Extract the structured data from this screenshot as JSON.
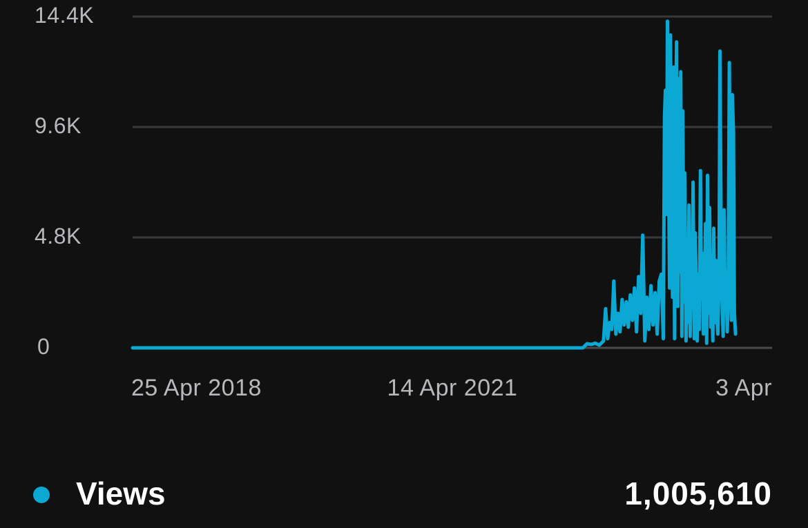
{
  "colors": {
    "background": "#111112",
    "series": "#0aa8d3",
    "grid": "#38383c",
    "tick_text": "#b8b8bd"
  },
  "chart_data": {
    "type": "line",
    "grid": true,
    "ylim": [
      0,
      14400
    ],
    "y_ticks": [
      {
        "value": 0,
        "label": "0"
      },
      {
        "value": 4800,
        "label": "4.8K"
      },
      {
        "value": 9600,
        "label": "9.6K"
      },
      {
        "value": 14400,
        "label": "14.4K"
      }
    ],
    "xlim": [
      "2018-04-25",
      "2024-04-03"
    ],
    "x_ticks": [
      {
        "value": "2018-04-25",
        "label": "25 Apr 2018"
      },
      {
        "value": "2021-04-14",
        "label": "14 Apr 2021"
      },
      {
        "value": "2024-04-03",
        "label": "3 Apr"
      }
    ],
    "series": [
      {
        "name": "Views",
        "points": [
          [
            "2018-04-25",
            0
          ],
          [
            "2018-10-25",
            0
          ],
          [
            "2019-04-25",
            0
          ],
          [
            "2019-10-25",
            0
          ],
          [
            "2020-04-25",
            0
          ],
          [
            "2020-10-25",
            0
          ],
          [
            "2021-04-14",
            0
          ],
          [
            "2021-10-14",
            0
          ],
          [
            "2022-04-14",
            0
          ],
          [
            "2022-06-01",
            0
          ],
          [
            "2022-07-01",
            0
          ],
          [
            "2022-07-15",
            180
          ],
          [
            "2022-07-29",
            150
          ],
          [
            "2022-08-12",
            200
          ],
          [
            "2022-08-26",
            120
          ],
          [
            "2022-09-09",
            300
          ],
          [
            "2022-09-16",
            1700
          ],
          [
            "2022-09-23",
            400
          ],
          [
            "2022-09-30",
            1100
          ],
          [
            "2022-10-07",
            800
          ],
          [
            "2022-10-14",
            2900
          ],
          [
            "2022-10-21",
            600
          ],
          [
            "2022-10-28",
            1500
          ],
          [
            "2022-11-04",
            700
          ],
          [
            "2022-11-11",
            2100
          ],
          [
            "2022-11-18",
            1000
          ],
          [
            "2022-11-25",
            2000
          ],
          [
            "2022-12-02",
            900
          ],
          [
            "2022-12-09",
            2300
          ],
          [
            "2022-12-16",
            1200
          ],
          [
            "2022-12-23",
            2600
          ],
          [
            "2022-12-30",
            700
          ],
          [
            "2023-01-06",
            3100
          ],
          [
            "2023-01-13",
            1500
          ],
          [
            "2023-01-20",
            4900
          ],
          [
            "2023-01-27",
            300
          ],
          [
            "2023-02-03",
            2200
          ],
          [
            "2023-02-10",
            800
          ],
          [
            "2023-02-17",
            2700
          ],
          [
            "2023-02-24",
            1000
          ],
          [
            "2023-03-03",
            2400
          ],
          [
            "2023-03-10",
            600
          ],
          [
            "2023-03-17",
            2900
          ],
          [
            "2023-03-24",
            3200
          ],
          [
            "2023-03-31",
            400
          ],
          [
            "2023-04-04",
            10000
          ],
          [
            "2023-04-07",
            11200
          ],
          [
            "2023-04-11",
            5800
          ],
          [
            "2023-04-14",
            14200
          ],
          [
            "2023-04-17",
            9300
          ],
          [
            "2023-04-21",
            2600
          ],
          [
            "2023-04-24",
            13600
          ],
          [
            "2023-04-28",
            6200
          ],
          [
            "2023-05-01",
            2200
          ],
          [
            "2023-05-05",
            12200
          ],
          [
            "2023-05-08",
            400
          ],
          [
            "2023-05-12",
            9800
          ],
          [
            "2023-05-15",
            13300
          ],
          [
            "2023-05-19",
            1800
          ],
          [
            "2023-05-22",
            11700
          ],
          [
            "2023-05-26",
            3300
          ],
          [
            "2023-05-29",
            12000
          ],
          [
            "2023-06-02",
            500
          ],
          [
            "2023-06-05",
            10300
          ],
          [
            "2023-06-09",
            2000
          ],
          [
            "2023-06-12",
            7600
          ],
          [
            "2023-06-16",
            300
          ],
          [
            "2023-06-19",
            4200
          ],
          [
            "2023-06-23",
            1100
          ],
          [
            "2023-06-26",
            6200
          ],
          [
            "2023-06-30",
            500
          ],
          [
            "2023-07-03",
            3100
          ],
          [
            "2023-07-07",
            1800
          ],
          [
            "2023-07-10",
            7200
          ],
          [
            "2023-07-14",
            400
          ],
          [
            "2023-07-17",
            5000
          ],
          [
            "2023-07-21",
            2700
          ],
          [
            "2023-07-24",
            300
          ],
          [
            "2023-07-28",
            3200
          ],
          [
            "2023-07-31",
            800
          ],
          [
            "2023-08-04",
            7700
          ],
          [
            "2023-08-07",
            2100
          ],
          [
            "2023-08-11",
            4100
          ],
          [
            "2023-08-14",
            600
          ],
          [
            "2023-08-18",
            2500
          ],
          [
            "2023-08-21",
            5400
          ],
          [
            "2023-08-25",
            200
          ],
          [
            "2023-08-28",
            7500
          ],
          [
            "2023-09-01",
            1500
          ],
          [
            "2023-09-04",
            6100
          ],
          [
            "2023-09-08",
            900
          ],
          [
            "2023-09-11",
            2400
          ],
          [
            "2023-09-15",
            300
          ],
          [
            "2023-09-18",
            5200
          ],
          [
            "2023-09-22",
            1100
          ],
          [
            "2023-09-25",
            3800
          ],
          [
            "2023-09-29",
            1400
          ],
          [
            "2023-10-02",
            600
          ],
          [
            "2023-10-06",
            3000
          ],
          [
            "2023-10-09",
            12900
          ],
          [
            "2023-10-13",
            4800
          ],
          [
            "2023-10-16",
            2100
          ],
          [
            "2023-10-20",
            500
          ],
          [
            "2023-10-23",
            6000
          ],
          [
            "2023-10-27",
            1800
          ],
          [
            "2023-10-30",
            3100
          ],
          [
            "2023-11-03",
            700
          ],
          [
            "2023-11-06",
            2200
          ],
          [
            "2023-11-10",
            12400
          ],
          [
            "2023-11-13",
            6100
          ],
          [
            "2023-11-17",
            1200
          ],
          [
            "2023-11-20",
            11000
          ],
          [
            "2023-11-24",
            9400
          ],
          [
            "2023-11-27",
            1500
          ],
          [
            "2023-12-01",
            600
          ]
        ]
      }
    ]
  },
  "legend": {
    "series_label": "Views",
    "total_value": "1,005,610"
  }
}
